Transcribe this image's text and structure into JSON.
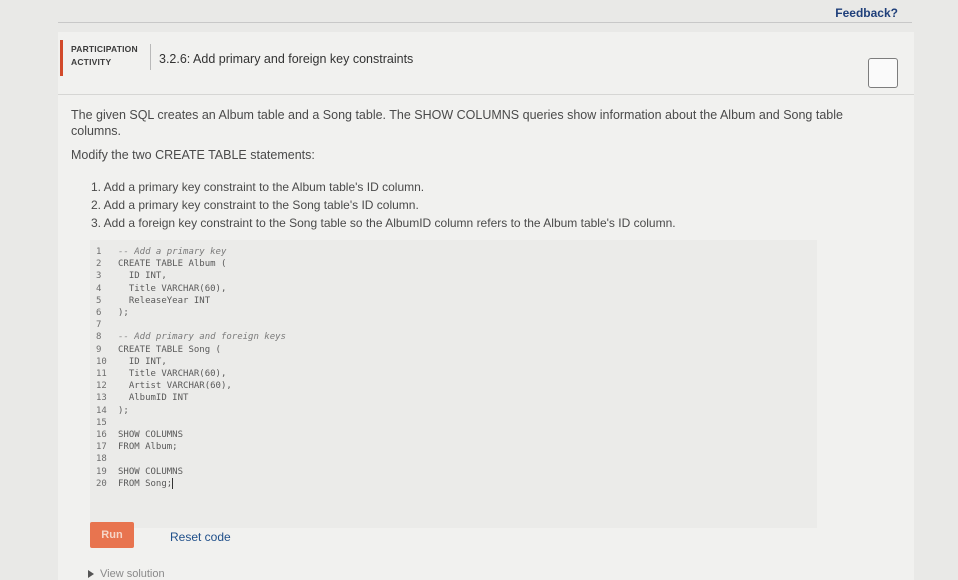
{
  "feedback_label": "Feedback?",
  "activity": {
    "type_line1": "PARTICIPATION",
    "type_line2": "ACTIVITY",
    "title": "3.2.6: Add primary and foreign key constraints"
  },
  "instructions": {
    "description": "The given SQL creates an Album table and a Song table. The SHOW COLUMNS queries show information about the Album and Song table columns.",
    "modify": "Modify the two CREATE TABLE statements:",
    "steps": [
      "1. Add a primary key constraint to the Album table's ID column.",
      "2. Add a primary key constraint to the Song table's ID column.",
      "3. Add a foreign key constraint to the Song table so the AlbumID column refers to the Album table's ID column."
    ]
  },
  "code": {
    "numbers": [
      "1",
      "2",
      "3",
      "4",
      "5",
      "6",
      "7",
      "8",
      "9",
      "10",
      "11",
      "12",
      "13",
      "14",
      "15",
      "16",
      "17",
      "18",
      "19",
      "20"
    ],
    "lines": [
      "-- Add a primary key",
      "CREATE TABLE Album (",
      "  ID INT,",
      "  Title VARCHAR(60),",
      "  ReleaseYear INT",
      ");",
      "",
      "-- Add primary and foreign keys",
      "CREATE TABLE Song (",
      "  ID INT,",
      "  Title VARCHAR(60),",
      "  Artist VARCHAR(60),",
      "  AlbumID INT",
      ");",
      "",
      "SHOW COLUMNS",
      "FROM Album;",
      "",
      "SHOW COLUMNS",
      "FROM Song;"
    ]
  },
  "buttons": {
    "run": "Run",
    "reset": "Reset code",
    "view_solution": "View solution"
  }
}
